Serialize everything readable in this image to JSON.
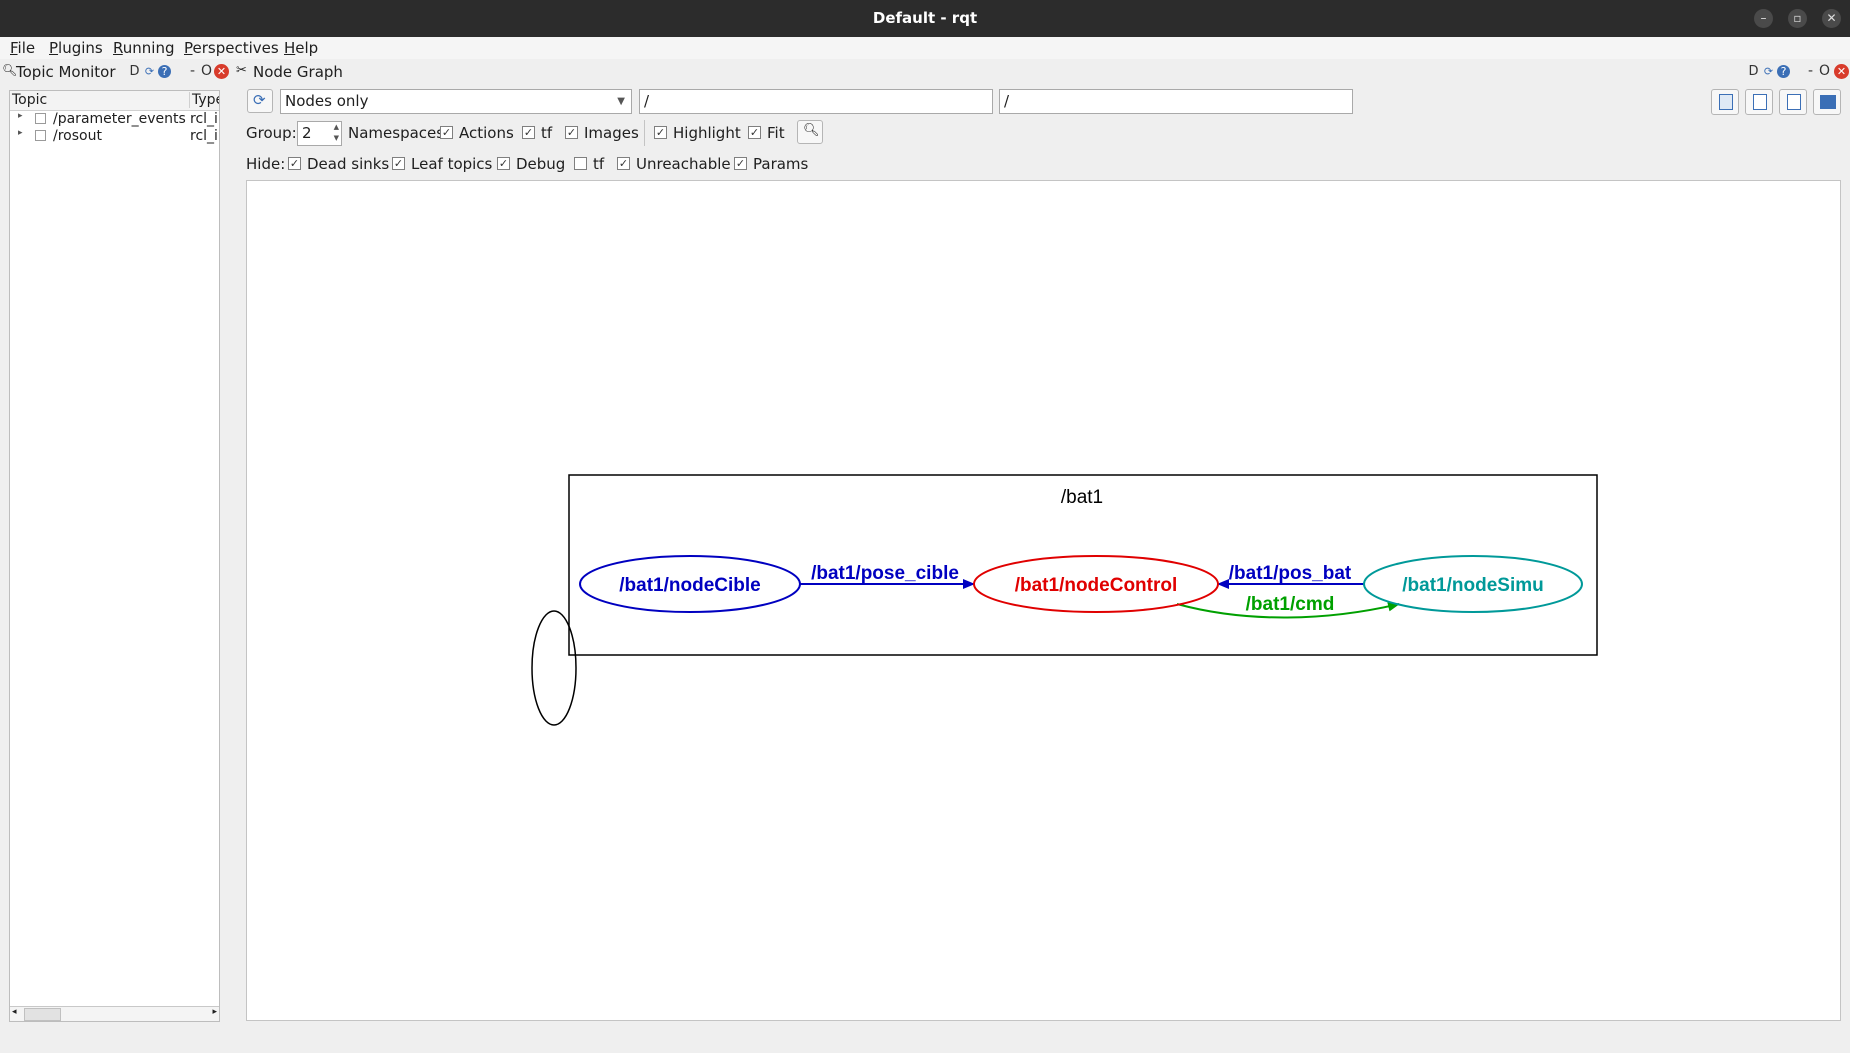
{
  "window": {
    "title": "Default - rqt"
  },
  "menubar": {
    "items": [
      {
        "label": "File",
        "accel": "F",
        "rest": "ile"
      },
      {
        "label": "Plugins",
        "accel": "P",
        "rest": "lugins"
      },
      {
        "label": "Running",
        "accel": "R",
        "rest": "unning"
      },
      {
        "label": "Perspectives",
        "accel": "P",
        "rest": "erspectives"
      },
      {
        "label": "Help",
        "accel": "H",
        "rest": "elp"
      }
    ]
  },
  "topic_monitor": {
    "title": "Topic Monitor",
    "controls": {
      "d": "D",
      "minus": "-",
      "o": "O"
    },
    "columns": [
      "Topic",
      "Type"
    ],
    "rows": [
      {
        "topic": "/parameter_events",
        "type": "rcl_ir"
      },
      {
        "topic": "/rosout",
        "type": "rcl_ir"
      }
    ]
  },
  "node_graph": {
    "title": "Node Graph",
    "controls": {
      "d": "D",
      "minus": "-",
      "o": "O"
    },
    "mode": "Nodes only",
    "filter1": "/",
    "filter2": "/",
    "group_label": "Group:",
    "group_value": "2",
    "options": [
      {
        "label": "Namespaces",
        "checked": true,
        "box_first": false
      },
      {
        "label": "Actions",
        "checked": true
      },
      {
        "label": "tf",
        "checked": true
      },
      {
        "label": "Images",
        "checked": true
      },
      {
        "label": "Highlight",
        "checked": true
      },
      {
        "label": "Fit",
        "checked": true
      }
    ],
    "hide_label": "Hide:",
    "hide": [
      {
        "label": "Dead sinks",
        "checked": true
      },
      {
        "label": "Leaf topics",
        "checked": true
      },
      {
        "label": "Debug",
        "checked": true
      },
      {
        "label": "tf",
        "checked": false
      },
      {
        "label": "Unreachable",
        "checked": true
      },
      {
        "label": "Params",
        "checked": true
      }
    ],
    "graph": {
      "cluster": "/bat1",
      "nodes": [
        {
          "name": "/bat1/nodeCible",
          "color": "#0000c0"
        },
        {
          "name": "/bat1/nodeControl",
          "color": "#e00000"
        },
        {
          "name": "/bat1/nodeSimu",
          "color": "#009999"
        }
      ],
      "edges": [
        {
          "label": "/bat1/pose_cible",
          "from": "/bat1/nodeCible",
          "to": "/bat1/nodeControl",
          "color": "#0000c0"
        },
        {
          "label": "/bat1/pos_bat",
          "from": "/bat1/nodeSimu",
          "to": "/bat1/nodeControl",
          "color": "#0000c0"
        },
        {
          "label": "/bat1/cmd",
          "from": "/bat1/nodeControl",
          "to": "/bat1/nodeSimu",
          "color": "#00a000"
        }
      ]
    }
  }
}
